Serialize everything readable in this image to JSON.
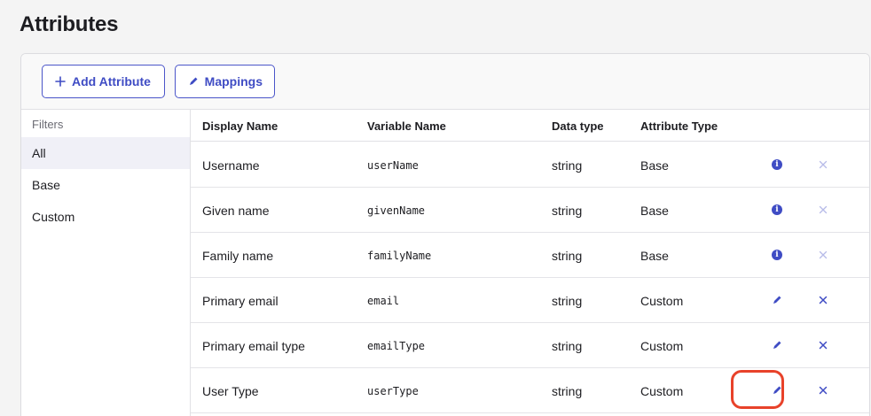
{
  "page": {
    "title": "Attributes"
  },
  "toolbar": {
    "add_label": "Add Attribute",
    "add_icon": "plus-icon",
    "mappings_label": "Mappings",
    "mappings_icon": "pencil-icon",
    "accent_color": "#3f4cc4"
  },
  "filters": {
    "heading": "Filters",
    "items": [
      {
        "label": "All",
        "active": true
      },
      {
        "label": "Base",
        "active": false
      },
      {
        "label": "Custom",
        "active": false
      }
    ]
  },
  "table": {
    "columns": [
      "Display Name",
      "Variable Name",
      "Data type",
      "Attribute Type"
    ],
    "rows": [
      {
        "display": "Username",
        "variable": "userName",
        "type": "string",
        "attr": "Base",
        "action": "info-icon",
        "remove": "close-icon",
        "remove_enabled": false
      },
      {
        "display": "Given name",
        "variable": "givenName",
        "type": "string",
        "attr": "Base",
        "action": "info-icon",
        "remove": "close-icon",
        "remove_enabled": false
      },
      {
        "display": "Family name",
        "variable": "familyName",
        "type": "string",
        "attr": "Base",
        "action": "info-icon",
        "remove": "close-icon",
        "remove_enabled": false
      },
      {
        "display": "Primary email",
        "variable": "email",
        "type": "string",
        "attr": "Custom",
        "action": "pencil-icon",
        "remove": "close-icon",
        "remove_enabled": true
      },
      {
        "display": "Primary email type",
        "variable": "emailType",
        "type": "string",
        "attr": "Custom",
        "action": "pencil-icon",
        "remove": "close-icon",
        "remove_enabled": true
      },
      {
        "display": "User Type",
        "variable": "userType",
        "type": "string",
        "attr": "Custom",
        "action": "pencil-icon",
        "remove": "close-icon",
        "remove_enabled": true
      }
    ]
  },
  "annotation": {
    "highlight_color": "#e8422a"
  }
}
